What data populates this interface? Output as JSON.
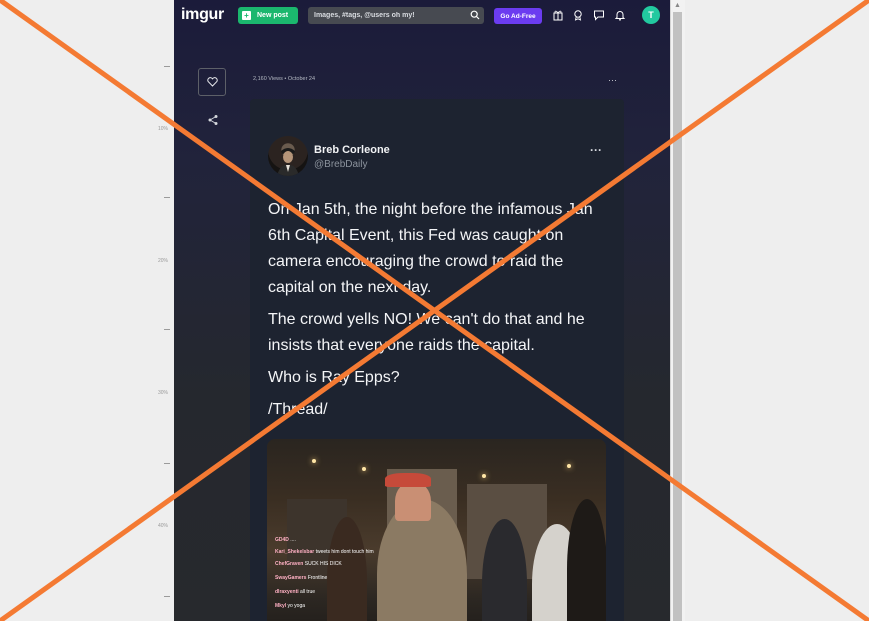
{
  "ruler": {
    "labels": [
      "10%",
      "20%",
      "30%",
      "40%"
    ]
  },
  "header": {
    "logo": "imgur",
    "new_post_label": "New post",
    "search_placeholder": "Images, #tags, @users oh my!",
    "go_ad_free_label": "Go Ad-Free",
    "avatar_initial": "T"
  },
  "post": {
    "meta": "2,160 Views • October 24",
    "more_label": "···"
  },
  "tweet": {
    "name": "Breb Corleone",
    "handle": "@BrebDaily",
    "more_label": "···",
    "paragraphs": [
      "On Jan 5th, the night before the infamous Jan 6th Capital Event, this Fed was caught on camera encouraging the crowd to raid the capital on the next day.",
      "The crowd yells NO! We can't do that and he insists that everyone raids the capital.",
      "Who is Ray Epps?",
      "/Thread/"
    ]
  },
  "video": {
    "chat": [
      {
        "user": "GD4D",
        "msg": "...."
      },
      {
        "user": "Kari_Shekelsbar",
        "msg": "tweets him dont touch him"
      },
      {
        "user": "ChefGraven",
        "msg": "SUCK HIS DICK"
      },
      {
        "user": "SwayGamers",
        "msg": "Frontline"
      },
      {
        "user": "dlraxyenti",
        "msg": "all true"
      },
      {
        "user": "Mkyl",
        "msg": "yo yoga"
      }
    ]
  },
  "colors": {
    "overlay_x": "#f47a33",
    "new_post_green": "#1bb76e",
    "ad_free_purple": "#6b3cf0",
    "avatar_teal": "#22c9a0"
  }
}
